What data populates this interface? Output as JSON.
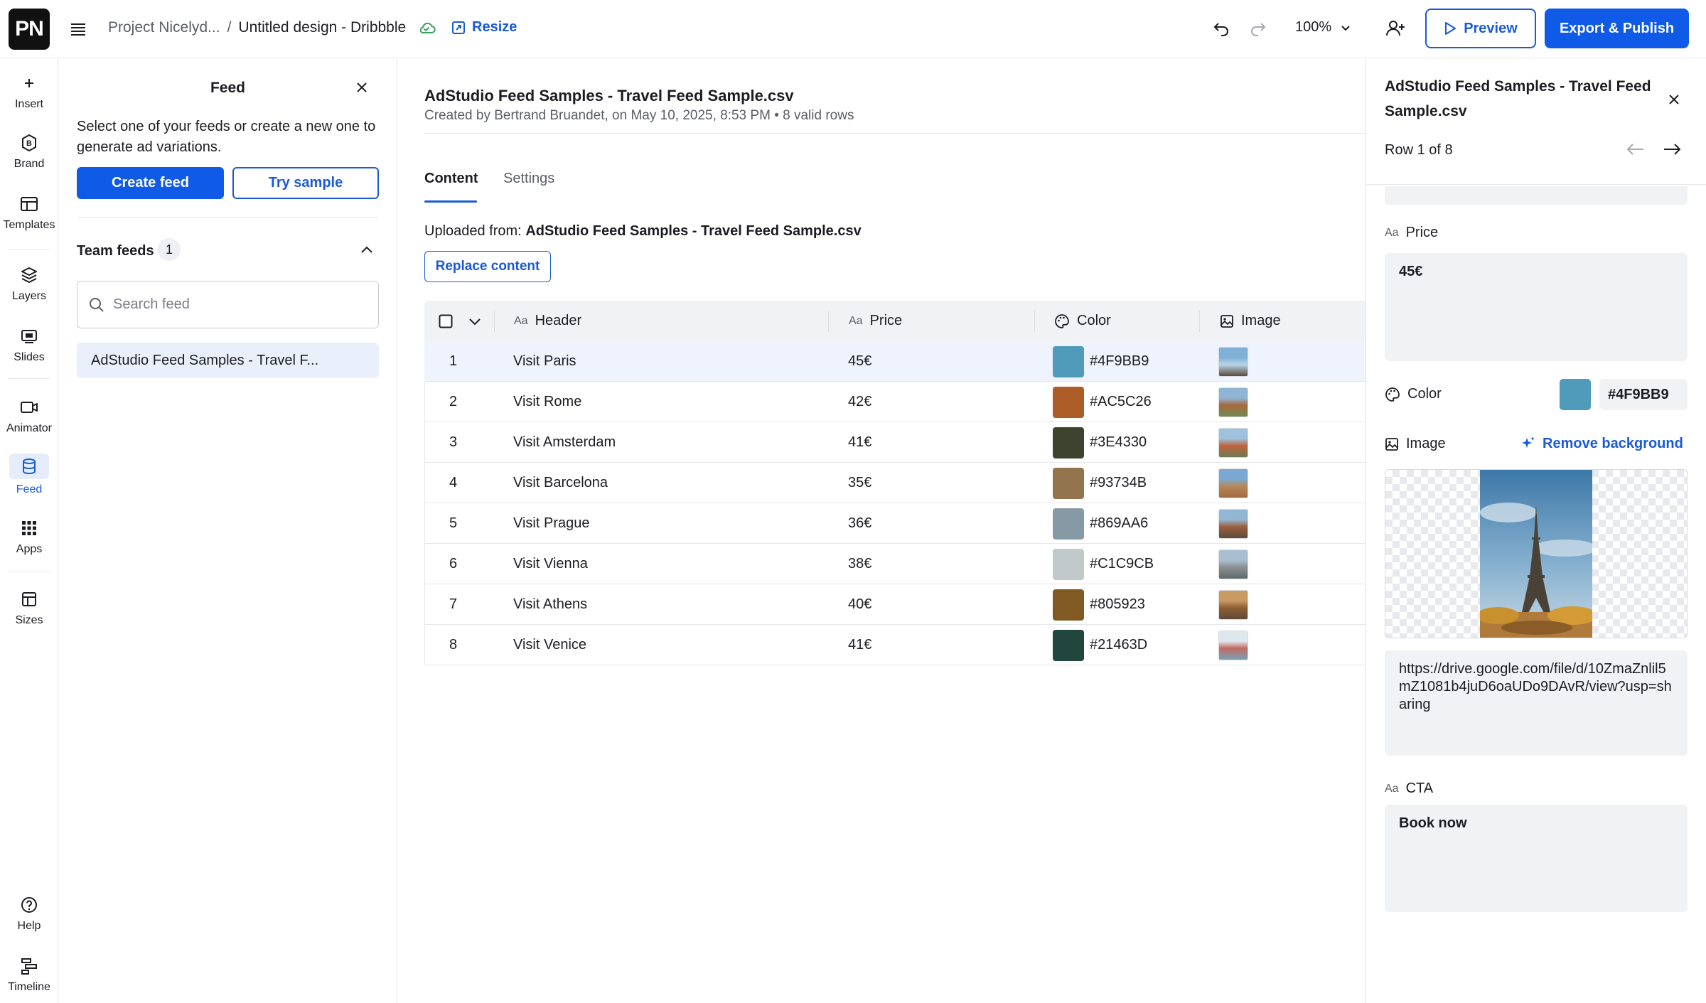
{
  "header": {
    "logo": "PN",
    "project": "Project Nicelyd...",
    "separator": "/",
    "design_title": "Untitled design - Dribbble",
    "resize_label": "Resize",
    "zoom": "100%",
    "preview_label": "Preview",
    "publish_label": "Export & Publish"
  },
  "rail": {
    "items": [
      {
        "label": "Insert",
        "icon": "plus-icon"
      },
      {
        "label": "Brand",
        "icon": "brand-icon"
      },
      {
        "label": "Templates",
        "icon": "templates-icon"
      },
      {
        "label": "Layers",
        "icon": "layers-icon"
      },
      {
        "label": "Slides",
        "icon": "slides-icon"
      },
      {
        "label": "Animator",
        "icon": "video-icon"
      },
      {
        "label": "Feed",
        "icon": "database-icon"
      },
      {
        "label": "Apps",
        "icon": "grid-icon"
      },
      {
        "label": "Sizes",
        "icon": "sizes-icon"
      },
      {
        "label": "Help",
        "icon": "help-icon"
      },
      {
        "label": "Timeline",
        "icon": "timeline-icon"
      }
    ]
  },
  "feed_panel": {
    "title": "Feed",
    "description": "Select one of your feeds or create a new one to generate ad variations.",
    "create_label": "Create feed",
    "sample_label": "Try sample",
    "team_label": "Team feeds",
    "team_count": "1",
    "search_placeholder": "Search feed",
    "feed_item": "AdStudio Feed Samples - Travel F..."
  },
  "main": {
    "title": "AdStudio Feed Samples - Travel Feed Sample.csv",
    "subtitle_prefix": "Created by Bertrand Bruandet, on May 10, 2025, 8:53 PM",
    "subtitle_bullet": "•",
    "subtitle_rows": "8 valid rows",
    "tabs": [
      {
        "label": "Content"
      },
      {
        "label": "Settings"
      }
    ],
    "uploaded_label": "Uploaded from:",
    "uploaded_file": "AdStudio Feed Samples - Travel Feed Sample.csv",
    "replace_label": "Replace content",
    "columns": {
      "header": "Header",
      "price": "Price",
      "color": "Color",
      "image": "Image",
      "aa": "Aa"
    },
    "rows": [
      {
        "n": "1",
        "header": "Visit Paris",
        "price": "45€",
        "color": "#4F9BB9"
      },
      {
        "n": "2",
        "header": "Visit Rome",
        "price": "42€",
        "color": "#AC5C26"
      },
      {
        "n": "3",
        "header": "Visit Amsterdam",
        "price": "41€",
        "color": "#3E4330"
      },
      {
        "n": "4",
        "header": "Visit Barcelona",
        "price": "35€",
        "color": "#93734B"
      },
      {
        "n": "5",
        "header": "Visit Prague",
        "price": "36€",
        "color": "#869AA6"
      },
      {
        "n": "6",
        "header": "Visit Vienna",
        "price": "38€",
        "color": "#C1C9CB"
      },
      {
        "n": "7",
        "header": "Visit Athens",
        "price": "40€",
        "color": "#805923"
      },
      {
        "n": "8",
        "header": "Visit Venice",
        "price": "41€",
        "color": "#21463D"
      }
    ]
  },
  "right_panel": {
    "title": "AdStudio Feed Samples - Travel Feed Sample.csv",
    "row_info": "Row 1 of 8",
    "aa": "Aa",
    "price_label": "Price",
    "price_value": "45€",
    "color_label": "Color",
    "color_value": "#4F9BB9",
    "image_label": "Image",
    "remove_bg_label": "Remove background",
    "image_url": "https://drive.google.com/file/d/10ZmaZnlil5mZ1081b4juD6oaUDo9DAvR/view?usp=sharing",
    "cta_label": "CTA",
    "cta_value": "Book now"
  },
  "colors": {
    "accent": "#0F5AE6",
    "selected_row": "#EEF3FD",
    "field_bg": "#F1F2F4"
  }
}
